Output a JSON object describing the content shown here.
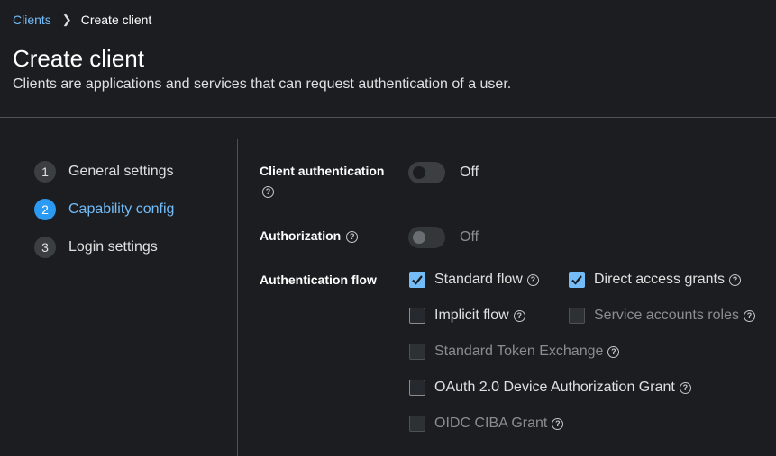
{
  "breadcrumb": {
    "parent": "Clients",
    "current": "Create client"
  },
  "header": {
    "title": "Create client",
    "subtitle": "Clients are applications and services that can request authentication of a user."
  },
  "steps": [
    {
      "number": "1",
      "label": "General settings"
    },
    {
      "number": "2",
      "label": "Capability config"
    },
    {
      "number": "3",
      "label": "Login settings"
    }
  ],
  "form": {
    "client_authentication": {
      "label": "Client authentication",
      "value": "Off"
    },
    "authorization": {
      "label": "Authorization",
      "value": "Off"
    },
    "authentication_flow": {
      "label": "Authentication flow",
      "options": [
        {
          "label": "Standard flow",
          "checked": true
        },
        {
          "label": "Direct access grants",
          "checked": true
        },
        {
          "label": "Implicit flow",
          "checked": false
        },
        {
          "label": "Service accounts roles",
          "checked": false,
          "disabled": true
        },
        {
          "label": "Standard Token Exchange",
          "checked": false,
          "disabled": true
        },
        {
          "label": "OAuth 2.0 Device Authorization Grant",
          "checked": false
        },
        {
          "label": "OIDC CIBA Grant",
          "checked": false,
          "disabled": true
        }
      ]
    }
  },
  "colors": {
    "accent": "#73bcf7",
    "active_step": "#2b9af3",
    "background": "#1b1d21"
  }
}
